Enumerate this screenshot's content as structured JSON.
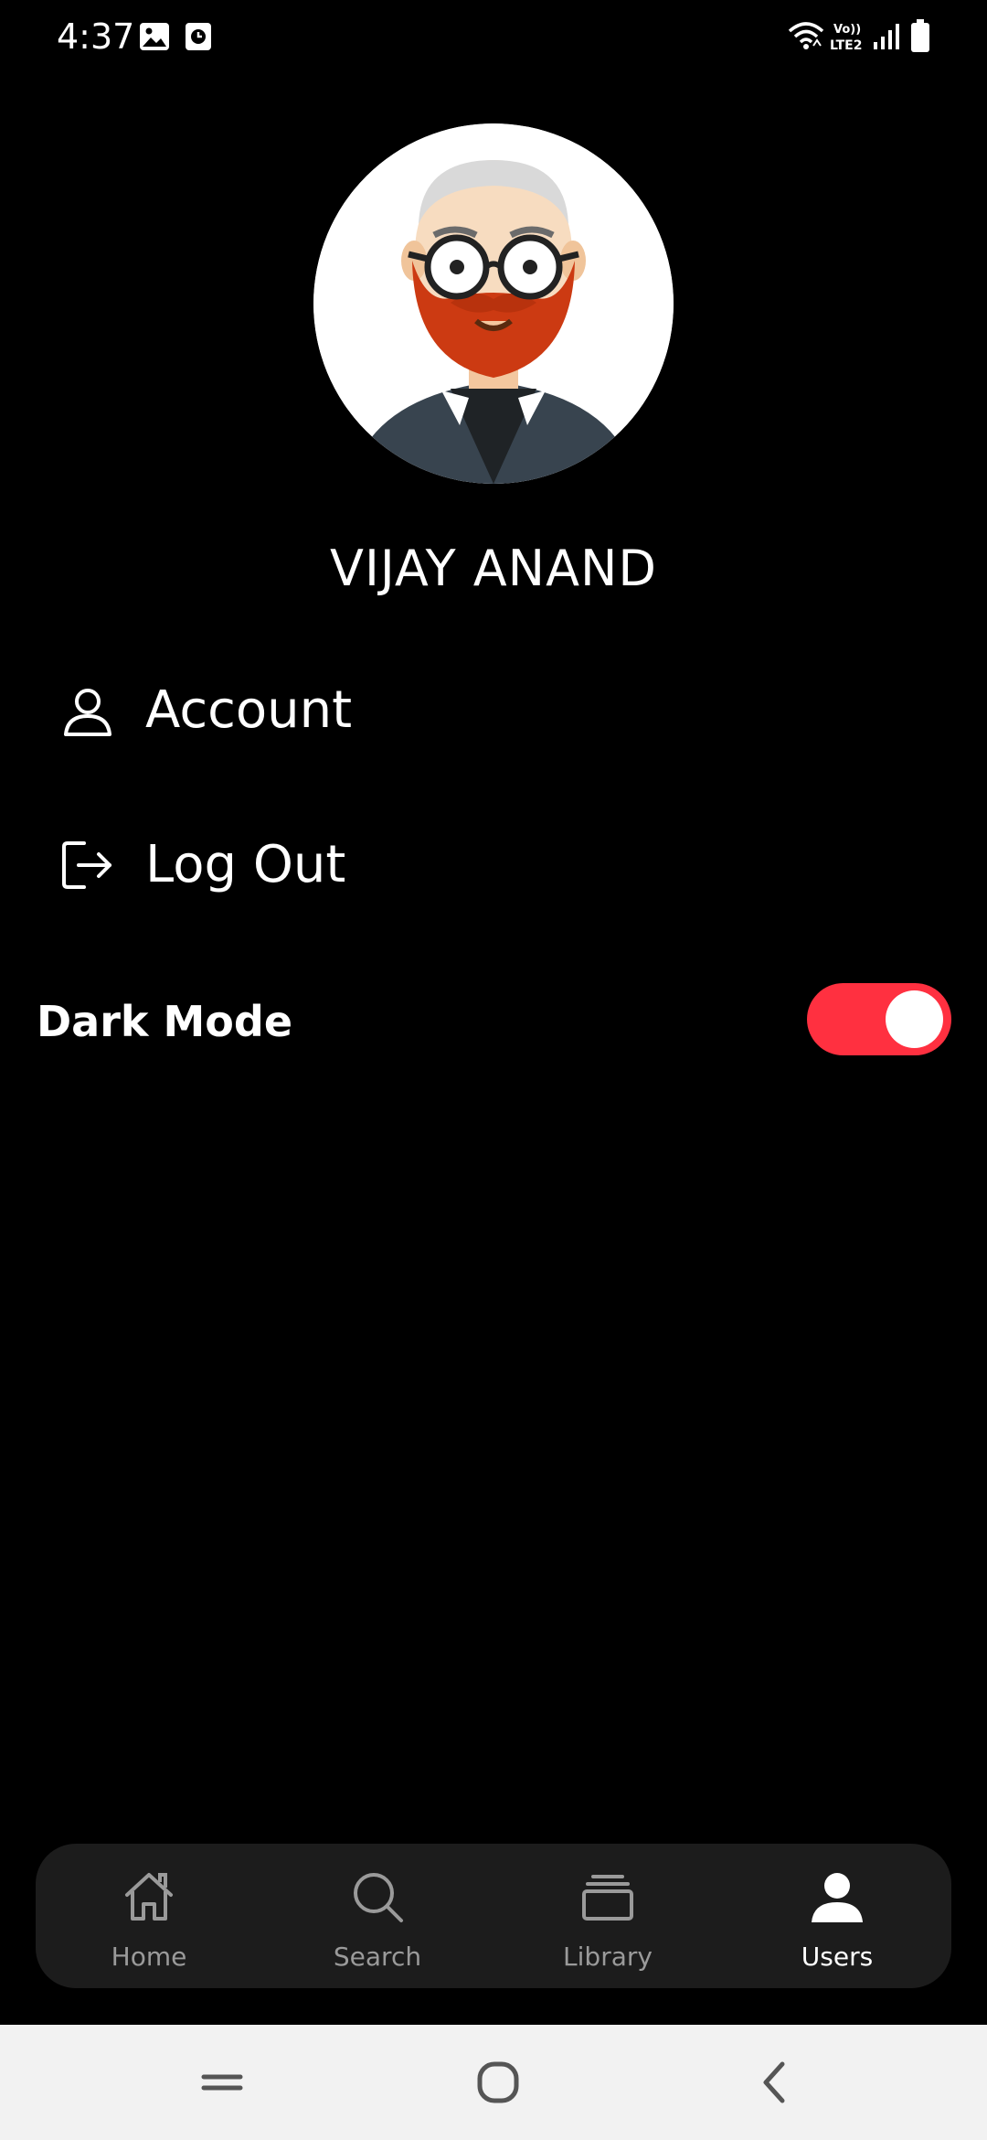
{
  "status_bar": {
    "time": "4:37",
    "icons": [
      "image-icon",
      "clock-icon",
      "wifi-icon",
      "volte-icon",
      "signal-icon",
      "battery-icon"
    ]
  },
  "profile": {
    "name": "VIJAY ANAND",
    "avatar_icon": "bearded-man-avatar"
  },
  "menu": {
    "items": [
      {
        "label": "Account",
        "icon": "user-outline-icon"
      },
      {
        "label": "Log Out",
        "icon": "logout-icon"
      }
    ]
  },
  "settings": {
    "dark_mode_label": "Dark Mode",
    "dark_mode_on": true
  },
  "bottom_nav": {
    "items": [
      {
        "label": "Home",
        "icon": "home-icon",
        "active": false
      },
      {
        "label": "Search",
        "icon": "search-icon",
        "active": false
      },
      {
        "label": "Library",
        "icon": "library-icon",
        "active": false
      },
      {
        "label": "Users",
        "icon": "user-filled-icon",
        "active": true
      }
    ]
  },
  "system_nav": {
    "buttons": [
      "recent-apps-icon",
      "home-circle-icon",
      "back-icon"
    ]
  },
  "colors": {
    "background": "#000000",
    "accent": "#ff3040",
    "nav_background": "#1c1c1c",
    "nav_inactive": "#9a9a9a",
    "system_nav_background": "#f2f2f2"
  }
}
